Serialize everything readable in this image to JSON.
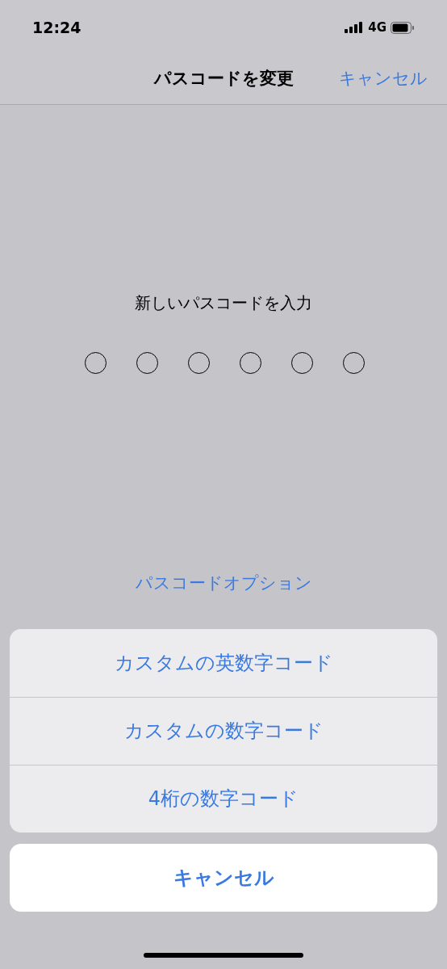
{
  "status_bar": {
    "time": "12:24",
    "network": "4G"
  },
  "nav_bar": {
    "title": "パスコードを変更",
    "cancel": "キャンセル"
  },
  "prompt": "新しいパスコードを入力",
  "passcode_dots": [
    {
      "filled": false
    },
    {
      "filled": false
    },
    {
      "filled": false
    },
    {
      "filled": false
    },
    {
      "filled": false
    },
    {
      "filled": false
    }
  ],
  "options_link": "パスコードオプション",
  "action_sheet": {
    "options": [
      "カスタムの英数字コード",
      "カスタムの数字コード",
      "4桁の数字コード"
    ],
    "cancel": "キャンセル"
  }
}
